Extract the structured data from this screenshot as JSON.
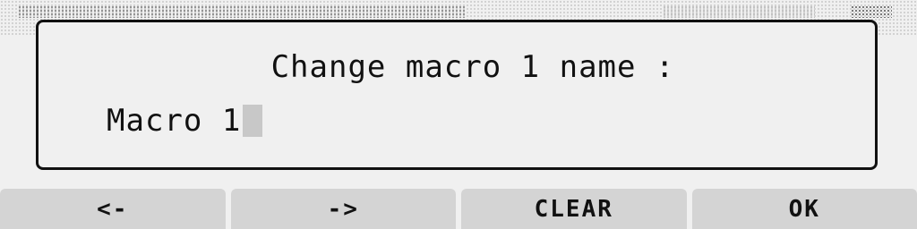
{
  "dialog": {
    "title": "Change macro 1 name :",
    "input_value": "Macro 1"
  },
  "softkeys": {
    "left": "<-",
    "right": "->",
    "clear": "CLEAR",
    "ok": "OK"
  },
  "colors": {
    "background": "#f0f0f0",
    "softkey_bg": "#d4d4d4",
    "text": "#111111",
    "cursor": "#c8c8c8"
  }
}
